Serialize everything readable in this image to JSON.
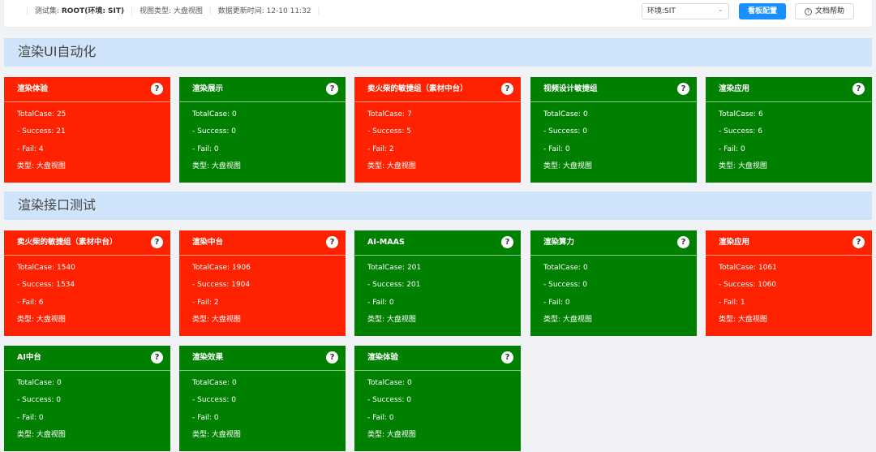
{
  "header": {
    "testset_label": "测试集:",
    "testset_value": "ROOT(环境: SIT)",
    "view_type_label": "视图类型:",
    "view_type_value": "大盘视图",
    "update_time_label": "数据更新时间:",
    "update_time_value": "12-10 11:32",
    "env_select_value": "环境:SIT",
    "board_config_label": "看板配置",
    "help_doc_label": "文档帮助"
  },
  "sections": [
    {
      "title": "渲染UI自动化",
      "cards": [
        {
          "title": "渲染体验",
          "status": "red",
          "total": "TotalCase: 25",
          "success": "- Success: 21",
          "fail": "- Fail: 4",
          "type": "类型: 大盘视图"
        },
        {
          "title": "渲染展示",
          "status": "green",
          "total": "TotalCase: 0",
          "success": "- Success: 0",
          "fail": "- Fail: 0",
          "type": "类型: 大盘视图"
        },
        {
          "title": "卖火柴的敏捷组（素材中台）",
          "status": "red",
          "total": "TotalCase: 7",
          "success": "- Success: 5",
          "fail": "- Fail: 2",
          "type": "类型: 大盘视图"
        },
        {
          "title": "视频设计敏捷组",
          "status": "green",
          "total": "TotalCase: 0",
          "success": "- Success: 0",
          "fail": "- Fail: 0",
          "type": "类型: 大盘视图"
        },
        {
          "title": "渲染应用",
          "status": "green",
          "total": "TotalCase: 6",
          "success": "- Success: 6",
          "fail": "- Fail: 0",
          "type": "类型: 大盘视图"
        }
      ]
    },
    {
      "title": "渲染接口测试",
      "cards": [
        {
          "title": "卖火柴的敏捷组（素材中台）",
          "status": "red",
          "total": "TotalCase: 1540",
          "success": "- Success: 1534",
          "fail": "- Fail: 6",
          "type": "类型: 大盘视图"
        },
        {
          "title": "渲染中台",
          "status": "red",
          "total": "TotalCase: 1906",
          "success": "- Success: 1904",
          "fail": "- Fail: 2",
          "type": "类型: 大盘视图"
        },
        {
          "title": "AI-MAAS",
          "status": "green",
          "total": "TotalCase: 201",
          "success": "- Success: 201",
          "fail": "- Fail: 0",
          "type": "类型: 大盘视图"
        },
        {
          "title": "渲染算力",
          "status": "green",
          "total": "TotalCase: 0",
          "success": "- Success: 0",
          "fail": "- Fail: 0",
          "type": "类型: 大盘视图"
        },
        {
          "title": "渲染应用",
          "status": "red",
          "total": "TotalCase: 1061",
          "success": "- Success: 1060",
          "fail": "- Fail: 1",
          "type": "类型: 大盘视图"
        },
        {
          "title": "AI中台",
          "status": "green",
          "total": "TotalCase: 0",
          "success": "- Success: 0",
          "fail": "- Fail: 0",
          "type": "类型: 大盘视图"
        },
        {
          "title": "渲染效果",
          "status": "green",
          "total": "TotalCase: 0",
          "success": "- Success: 0",
          "fail": "- Fail: 0",
          "type": "类型: 大盘视图"
        },
        {
          "title": "渲染体验",
          "status": "green",
          "total": "TotalCase: 0",
          "success": "- Success: 0",
          "fail": "- Fail: 0",
          "type": "类型: 大盘视图"
        }
      ]
    }
  ],
  "colors": {
    "fail": "#ff2200",
    "pass": "#008000",
    "section_bg": "#cfe4fb",
    "primary": "#1890ff"
  }
}
